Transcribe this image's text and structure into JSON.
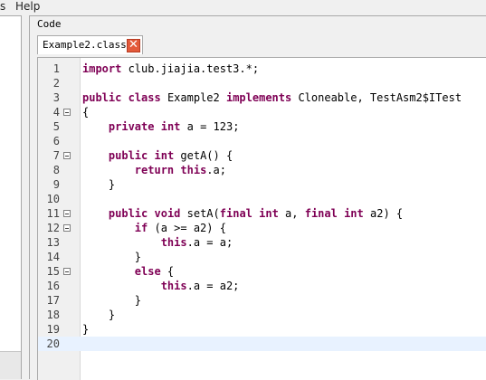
{
  "menubar": {
    "items": [
      {
        "label": "s"
      },
      {
        "label": "Help"
      }
    ]
  },
  "code_panel": {
    "title": "Code"
  },
  "tabs": [
    {
      "label": "Example2.class",
      "close_icon": "close-icon"
    }
  ],
  "editor": {
    "current_line": 20,
    "lines": [
      {
        "number": "1",
        "text": "import club.jiajia.test3.*;"
      },
      {
        "number": "2",
        "text": ""
      },
      {
        "number": "3",
        "text": "public class Example2 implements Cloneable, TestAsm2$ITest"
      },
      {
        "number": "4",
        "text": "{",
        "fold": true
      },
      {
        "number": "5",
        "text": "    private int a = 123;"
      },
      {
        "number": "6",
        "text": ""
      },
      {
        "number": "7",
        "text": "    public int getA() {",
        "fold": true
      },
      {
        "number": "8",
        "text": "        return this.a;"
      },
      {
        "number": "9",
        "text": "    }"
      },
      {
        "number": "10",
        "text": ""
      },
      {
        "number": "11",
        "text": "    public void setA(final int a, final int a2) {",
        "fold": true
      },
      {
        "number": "12",
        "text": "        if (a >= a2) {",
        "fold": true
      },
      {
        "number": "13",
        "text": "            this.a = a;"
      },
      {
        "number": "14",
        "text": "        }"
      },
      {
        "number": "15",
        "text": "        else {",
        "fold": true
      },
      {
        "number": "16",
        "text": "            this.a = a2;"
      },
      {
        "number": "17",
        "text": "        }"
      },
      {
        "number": "18",
        "text": "    }"
      },
      {
        "number": "19",
        "text": "}"
      },
      {
        "number": "20",
        "text": ""
      }
    ]
  }
}
